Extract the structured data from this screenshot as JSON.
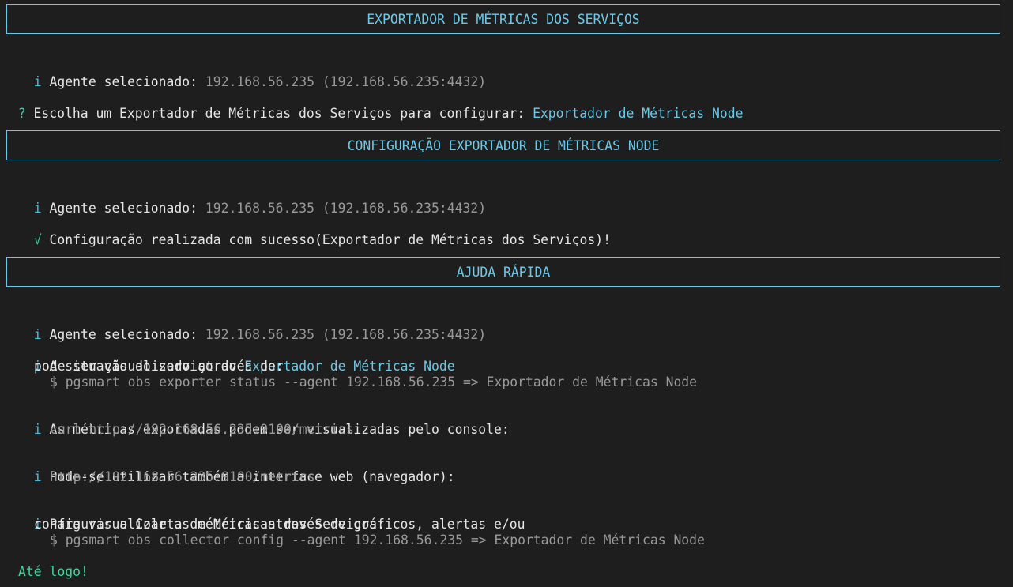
{
  "colors": {
    "background": "#1e1e1e",
    "text": "#e6e6e6",
    "banner": "#6fc8e6",
    "info_icon": "#4fb8d8",
    "muted": "#9a9a9a",
    "success": "#3ed79a"
  },
  "banners": {
    "exporters": "EXPORTADOR DE MÉTRICAS DOS SERVIÇOS",
    "node_config": "CONFIGURAÇÃO EXPORTADOR DE MÉTRICAS NODE",
    "quick_help": "AJUDA RÁPIDA"
  },
  "icons": {
    "info": "i",
    "question": "?",
    "check": "√"
  },
  "agent": {
    "label": "Agente selecionado: ",
    "value": "192.168.56.235 (192.168.56.235:4432)"
  },
  "prompt": {
    "question": "Escolha um Exportador de Métricas dos Serviços para configurar: ",
    "answer": "Exportador de Métricas Node"
  },
  "success": {
    "message": "Configuração realizada com sucesso(Exportador de Métricas dos Serviços)!"
  },
  "help": {
    "status_line1_prefix": "A situação do serviço do ",
    "status_line1_service": "Exportador de Métricas Node",
    "status_line2": "pode ser visualizado através de:",
    "status_cmd": "$ pgsmart obs exporter status --agent 192.168.56.235 => Exportador de Métricas Node",
    "console_line": "As métricas exportadas podem ser visualizadas pelo console:",
    "console_cmd": "curl http://192.168.56.235:9100/metrics",
    "web_line": "Pode-se utilizar também a interface web (navegador):",
    "web_url": "http://192.168.56.235:9100/metrics",
    "collector_line1": "Para visualizar as métricas através de gráficos, alertas e/ou",
    "collector_line2": "configurar o Coleta de Métricas dos Serviços:",
    "collector_cmd": "$ pgsmart obs collector config --agent 192.168.56.235 => Exportador de Métricas Node"
  },
  "farewell": "Até logo!"
}
